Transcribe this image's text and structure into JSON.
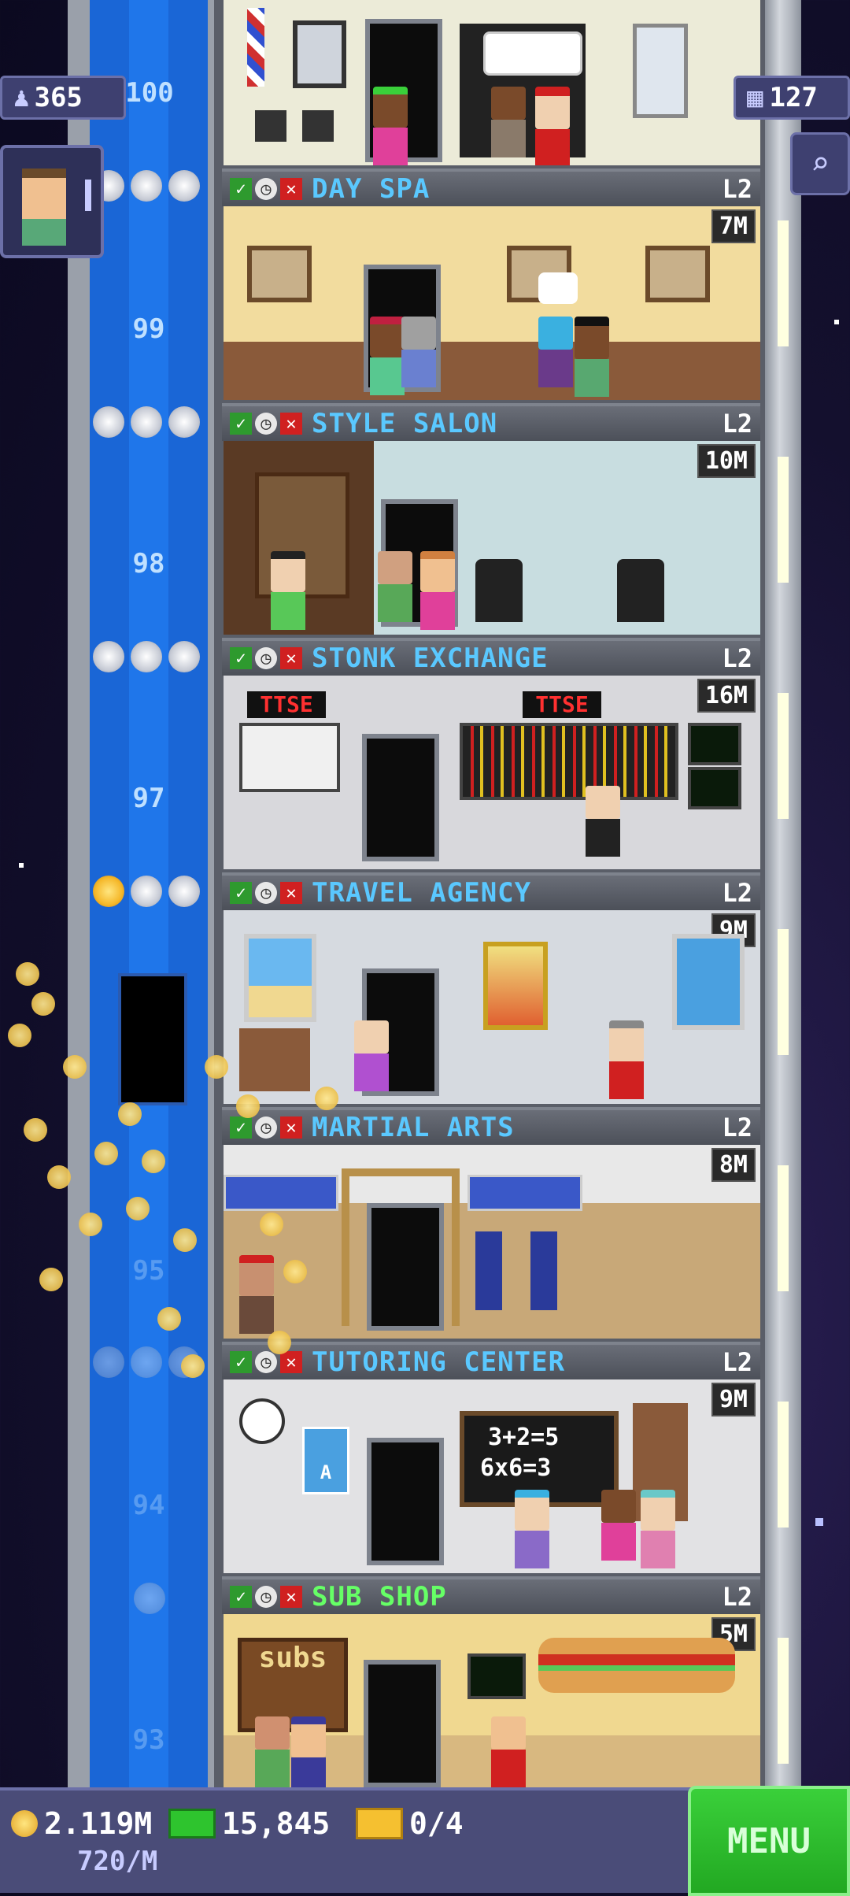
{
  "hud": {
    "population": "365",
    "floor_count": "127",
    "top_floor_number": "100"
  },
  "shaft_floors": [
    "99",
    "98",
    "97",
    "95",
    "94",
    "93"
  ],
  "floors": [
    {
      "name": "DAY SPA",
      "level": "L2",
      "price": "7M"
    },
    {
      "name": "STYLE SALON",
      "level": "L2",
      "price": "10M"
    },
    {
      "name": "STONK EXCHANGE",
      "level": "L2",
      "price": "16M"
    },
    {
      "name": "TRAVEL AGENCY",
      "level": "L2",
      "price": "9M"
    },
    {
      "name": "MARTIAL ARTS",
      "level": "L2",
      "price": "8M"
    },
    {
      "name": "TUTORING CENTER",
      "level": "L2",
      "price": "9M"
    },
    {
      "name": "SUB SHOP",
      "level": "L2",
      "price": "5M"
    }
  ],
  "signs": {
    "ttse_left": "TTSE",
    "ttse_right": "TTSE",
    "chalkboard_line1": "3+2=5",
    "chalkboard_line2": "6x6=3",
    "subs_sign": "subs",
    "apple_poster": "A"
  },
  "bottom": {
    "coins": "2.119M",
    "coins_rate": "720/M",
    "bux": "15,845",
    "tickets": "0/4",
    "menu_label": "MENU"
  },
  "colors": {
    "shaft_blue": "#1a66d6",
    "floor_name_blue": "#5ac8ff",
    "floor_name_green": "#66ff66",
    "menu_green": "#2ec42e"
  }
}
